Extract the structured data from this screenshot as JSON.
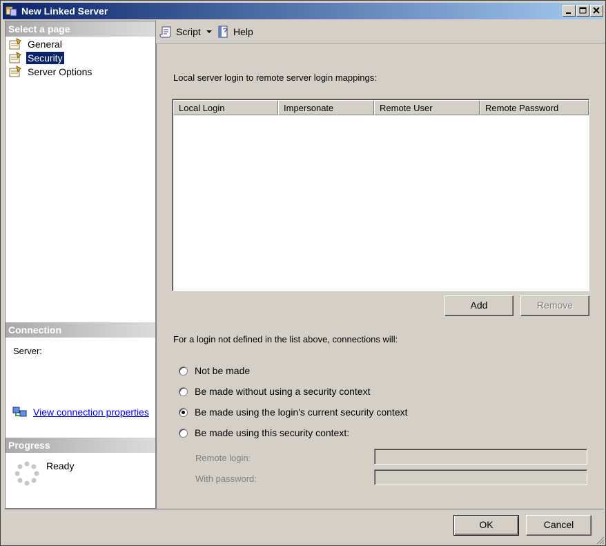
{
  "window": {
    "title": "New Linked Server"
  },
  "left": {
    "select_page_header": "Select a page",
    "pages": [
      {
        "label": "General",
        "selected": false
      },
      {
        "label": "Security",
        "selected": true
      },
      {
        "label": "Server Options",
        "selected": false
      }
    ],
    "connection_header": "Connection",
    "server_label": "Server:",
    "view_connection_link": "View connection properties",
    "progress_header": "Progress",
    "progress_status": "Ready"
  },
  "toolbar": {
    "script_label": "Script",
    "help_label": "Help"
  },
  "security": {
    "mapping_label": "Local server login to remote server login mappings:",
    "columns": [
      "Local Login",
      "Impersonate",
      "Remote User",
      "Remote Password"
    ],
    "rows": [],
    "add_label": "Add",
    "remove_label": "Remove",
    "undefined_login_label": "For a login not defined in the list above, connections will:",
    "options": [
      {
        "label": "Not be made",
        "checked": false
      },
      {
        "label": "Be made without using a security context",
        "checked": false
      },
      {
        "label": "Be made using the login's current security context",
        "checked": true
      },
      {
        "label": "Be made using this security context:",
        "checked": false
      }
    ],
    "remote_login_label": "Remote login:",
    "remote_login_value": "",
    "with_password_label": "With password:",
    "with_password_value": ""
  },
  "footer": {
    "ok_label": "OK",
    "cancel_label": "Cancel"
  }
}
